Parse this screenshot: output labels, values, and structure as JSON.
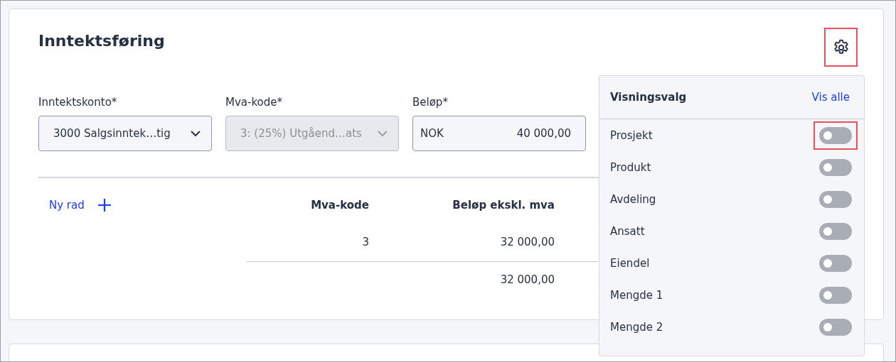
{
  "card": {
    "title": "Inntektsføring",
    "settings_button": {
      "highlighted": true
    }
  },
  "fields": [
    {
      "label": "Inntektskonto*",
      "kind": "select",
      "value": "3000 Salgsinntek…tig",
      "disabled": false
    },
    {
      "label": "Mva-kode*",
      "kind": "select",
      "value": "3: (25%) Utgåend…ats",
      "disabled": true
    },
    {
      "label": "Beløp*",
      "kind": "amount",
      "prefix": "NOK",
      "value": "40 000,00",
      "disabled": false
    }
  ],
  "table": {
    "add_row": "Ny rad",
    "columns": [
      "Mva-kode",
      "Beløp ekskl. mva"
    ],
    "rows": [
      [
        "3",
        "32 000,00"
      ]
    ],
    "total": "32 000,00"
  },
  "popup": {
    "title": "Visningsvalg",
    "show_all": "Vis alle",
    "options": [
      {
        "label": "Prosjekt",
        "on": false,
        "highlighted": true
      },
      {
        "label": "Produkt",
        "on": false,
        "highlighted": false
      },
      {
        "label": "Avdeling",
        "on": false,
        "highlighted": false
      },
      {
        "label": "Ansatt",
        "on": false,
        "highlighted": false
      },
      {
        "label": "Eiendel",
        "on": false,
        "highlighted": false
      },
      {
        "label": "Mengde 1",
        "on": false,
        "highlighted": false
      },
      {
        "label": "Mengde 2",
        "on": false,
        "highlighted": false
      }
    ]
  }
}
